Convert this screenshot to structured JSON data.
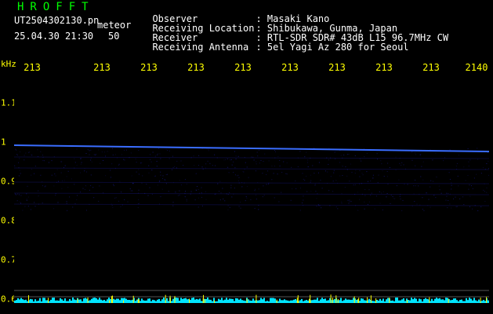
{
  "header": {
    "app_name": "HROFFT",
    "file_name": "UT2504302130.pn",
    "meteor_label": "meteor",
    "datetime": "25.04.30 21:30",
    "meteor_count": "50"
  },
  "info": [
    {
      "label": "Observer",
      "value": ": Masaki Kano"
    },
    {
      "label": "Receiving Location",
      "value": ": Shibukawa, Gunma, Japan"
    },
    {
      "label": "Receiver",
      "value": ": RTL-SDR SDR# 43dB L15 96.7MHz CW"
    },
    {
      "label": "Receiving Antenna",
      "value": ": 5el Yagi Az 280 for Seoul"
    }
  ],
  "axis": {
    "y_unit": "kHz",
    "x_ticks": [
      "213",
      "213",
      "213",
      "213",
      "213",
      "213",
      "213",
      "213",
      "213",
      "2140"
    ],
    "y_ticks": [
      "1.1",
      "1",
      "0.9",
      "0.8",
      "0.7",
      "0.6"
    ]
  },
  "colors": {
    "title": "#00ff00",
    "label": "#ffffff",
    "tick": "#ffff00",
    "carrier": "#3a6dff",
    "noise": "#1a1a8c",
    "spectrum_base": "#00e5ff",
    "spectrum_peak": "#ffff00"
  }
}
